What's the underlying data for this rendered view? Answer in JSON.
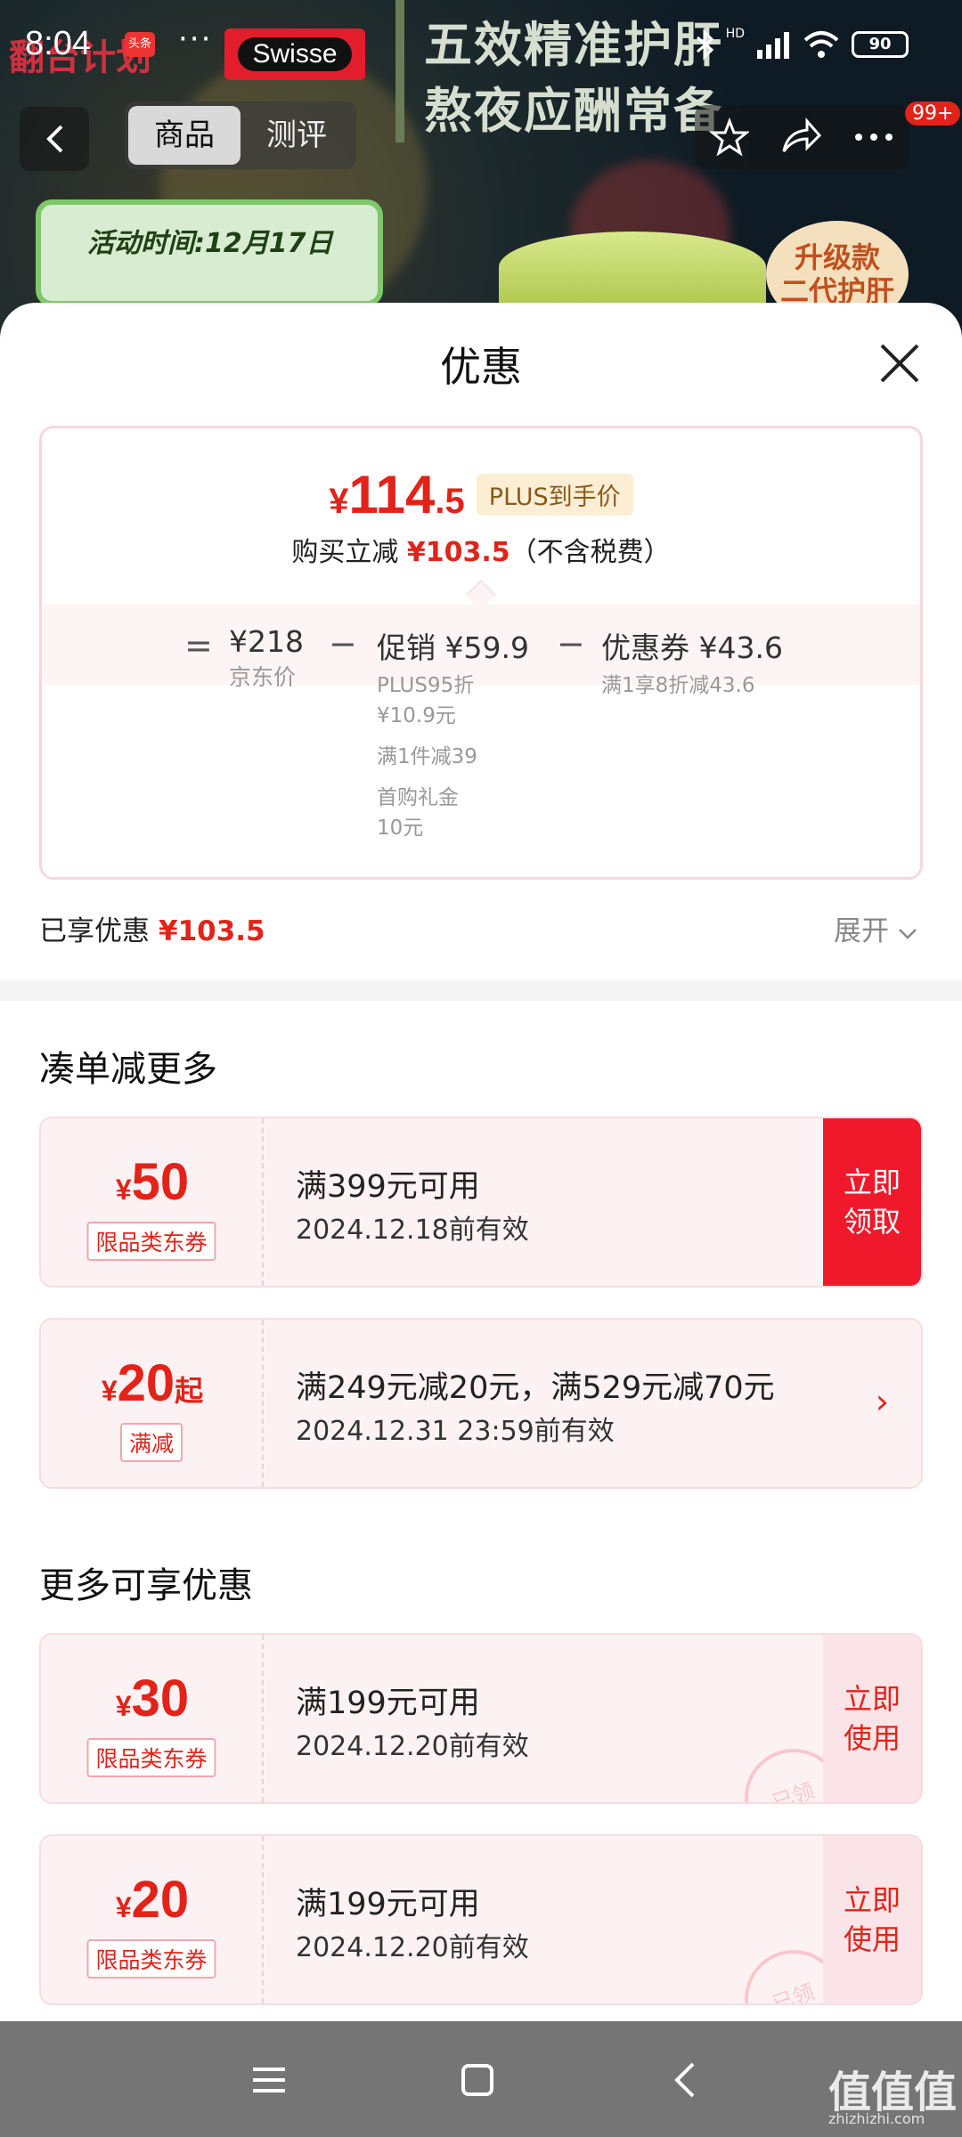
{
  "status_bar": {
    "time": "8:04",
    "notification_badge": "头条",
    "dots": "···",
    "network": "HD",
    "battery": "90"
  },
  "header": {
    "brand_promo": "翻台计划",
    "brand_logo": "Swisse",
    "promo_line1": "五效精准护肝",
    "promo_line2": "熬夜应酬常备",
    "tabs": [
      "商品",
      "测评"
    ],
    "active_tab": 0,
    "cart_badge": "99+",
    "activity_time": "活动时间:12月17日",
    "upgrade_badge": "升级款\n二代护肝"
  },
  "sheet": {
    "title": "优惠",
    "final_price": {
      "currency": "¥",
      "int": "114",
      "dec": ".5",
      "tag": "PLUS到手价"
    },
    "reduce_text": "购买立减",
    "reduce_amount": "¥103.5",
    "reduce_note": "（不含税费）",
    "breakdown": {
      "eq": "=",
      "jd_price": "¥218",
      "jd_label": "京东价",
      "minus1": "−",
      "promo_label": "促销",
      "promo_amount": "¥59.9",
      "promo_items": [
        "PLUS95折",
        "¥10.9元",
        "满1件减39",
        "首购礼金",
        "10元"
      ],
      "minus2": "−",
      "coupon_label": "优惠券",
      "coupon_amount": "¥43.6",
      "coupon_note": "满1享8折减43.6"
    },
    "enjoyed_label": "已享优惠",
    "enjoyed_amount": "¥103.5",
    "expand_label": "展开"
  },
  "section_more": {
    "title": "凑单减更多",
    "coupons": [
      {
        "yen": "¥",
        "amount": "50",
        "suffix": "",
        "kind": "限品类东券",
        "condition": "满399元可用",
        "expiry": "2024.12.18前有效",
        "action": "立即\n领取"
      },
      {
        "yen": "¥",
        "amount": "20",
        "suffix": "起",
        "kind": "满减",
        "condition": "满249元减20元，满529元减70元",
        "expiry": "2024.12.31 23:59前有效",
        "action": "›"
      }
    ]
  },
  "section_enjoy": {
    "title": "更多可享优惠",
    "coupons": [
      {
        "yen": "¥",
        "amount": "30",
        "kind": "限品类东券",
        "condition": "满199元可用",
        "expiry": "2024.12.20前有效",
        "action": "立即\n使用",
        "stamp": "已领"
      },
      {
        "yen": "¥",
        "amount": "20",
        "kind": "限品类东券",
        "condition": "满199元可用",
        "expiry": "2024.12.20前有效",
        "action": "立即\n使用",
        "stamp": "已领"
      }
    ]
  },
  "watermark": {
    "main": "值值值",
    "sub": "zhizhizhi.com"
  },
  "colors": {
    "accent": "#e2231a",
    "plus_tag_bg": "#fbeed4",
    "coupon_bg": "#fdf2f3",
    "nav_bg": "#757575"
  }
}
